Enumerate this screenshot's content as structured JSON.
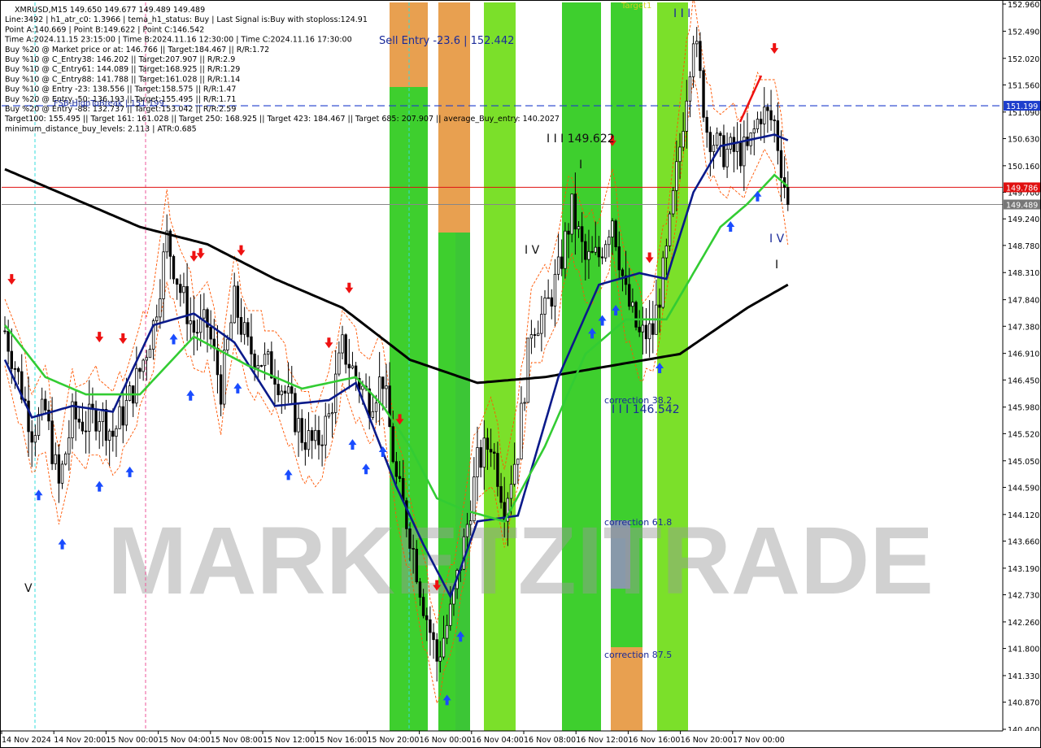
{
  "header": {
    "lines": [
      "XMRUSD,M15  149.650 149.677 149.489 149.489",
      "Line:3492 | h1_atr_c0: 1.3966 | tema_h1_status: Buy | Last Signal is:Buy with stoploss:124.91",
      "Point A:140.669 | Point B:149.622 | Point C:146.542",
      "Time A:2024.11.15 23:15:00 | Time B:2024.11.16 12:30:00 | Time C:2024.11.16 17:30:00",
      "Buy %20 @ Market price or at: 146.766 || Target:184.467 || R/R:1.72",
      "Buy %10 @ C_Entry38: 146.202 || Target:207.907 || R/R:2.9",
      "Buy %10 @ C_Entry61: 144.089 || Target:168.925 || R/R:1.29",
      "Buy %10 @ C_Entry88: 141.788 || Target:161.028 || R/R:1.14",
      "Buy %10 @ Entry -23: 138.556 || Target:158.575 || R/R:1.47",
      "Buy %20 @ Entry -50: 136.193 || Target:155.495 || R/R:1.71",
      "Buy %20 @ Entry -88: 132.737 || Target:153.042 || R/R:2.59",
      "Target100: 155.495 || Target 161: 161.028 || Target 250: 168.925 || Target 423: 184.467 || Target 685: 207.907 || average_Buy_entry: 140.2027",
      "minimum_distance_buy_levels: 2.113 | ATR:0.685"
    ]
  },
  "watermark": "MARKETZITRADE",
  "annotations": {
    "sell_entry": "Sell Entry -23.6 | 152.442",
    "target1": "Target1",
    "wave_B": "I I I 149.622",
    "wave_C": "I I I 146.542",
    "correction_382": "correction 38.2",
    "correction_618": "correction 61.8",
    "correction_875": "correction 87.5",
    "fsb": "FSB-HighToBreak | 151.199",
    "wave_top": "I I I",
    "wave_I_mid": "I",
    "wave_IV_mid": "I V",
    "wave_IV_right": "I V",
    "wave_I_right": "I",
    "wave_V_left": "V"
  },
  "price_axis": {
    "ticks": [
      "152.960",
      "152.490",
      "152.020",
      "151.560",
      "151.090",
      "150.630",
      "150.160",
      "149.700",
      "149.240",
      "148.780",
      "148.310",
      "147.840",
      "147.380",
      "146.910",
      "146.450",
      "145.980",
      "145.520",
      "145.050",
      "144.590",
      "144.120",
      "143.660",
      "143.190",
      "142.730",
      "142.260",
      "141.800",
      "141.330",
      "140.870",
      "140.400"
    ],
    "badges": [
      {
        "text": "151.199",
        "value": 151.199,
        "color": "#1e3ecc"
      },
      {
        "text": "149.786",
        "value": 149.786,
        "color": "#e01010"
      },
      {
        "text": "149.489",
        "value": 149.489,
        "color": "#777777"
      }
    ]
  },
  "time_axis": {
    "labels": [
      "14 Nov 2024",
      "14 Nov 20:00",
      "15 Nov 00:00",
      "15 Nov 04:00",
      "15 Nov 08:00",
      "15 Nov 12:00",
      "15 Nov 16:00",
      "15 Nov 20:00",
      "16 Nov 00:00",
      "16 Nov 04:00",
      "16 Nov 08:00",
      "16 Nov 12:00",
      "16 Nov 16:00",
      "16 Nov 20:00",
      "17 Nov 00:00"
    ]
  },
  "colors": {
    "zone_green": "#3ecf2e",
    "zone_green_light": "#7be02a",
    "zone_orange": "#e8a050",
    "ma_black": "#000000",
    "ma_navy": "#0a1a8a",
    "ma_green": "#33cc33",
    "envelope": "#ff5500",
    "buy_arrow": "#1a4cff",
    "sell_arrow": "#ee1111"
  },
  "chart_data": {
    "type": "candlestick",
    "symbol": "XMRUSD",
    "timeframe": "M15",
    "last_close": 149.489,
    "ylim": [
      140.4,
      152.96
    ],
    "levels": {
      "fsb_high_to_break": 151.199,
      "red_line": 149.786,
      "current_price": 149.489,
      "sell_entry": 152.442
    },
    "points": {
      "A": 140.669,
      "B": 149.622,
      "C": 146.542
    },
    "ohlc_path": [
      [
        0,
        147.3
      ],
      [
        4,
        146.5
      ],
      [
        8,
        145.6
      ],
      [
        12,
        145.9
      ],
      [
        16,
        144.6
      ],
      [
        20,
        145.8
      ],
      [
        24,
        145.7
      ],
      [
        28,
        145.9
      ],
      [
        32,
        145.5
      ],
      [
        36,
        146.0
      ],
      [
        40,
        146.6
      ],
      [
        44,
        147.4
      ],
      [
        48,
        148.9
      ],
      [
        52,
        148.0
      ],
      [
        56,
        147.3
      ],
      [
        60,
        147.4
      ],
      [
        64,
        146.3
      ],
      [
        68,
        147.8
      ],
      [
        72,
        147.0
      ],
      [
        76,
        146.8
      ],
      [
        80,
        146.6
      ],
      [
        84,
        146.1
      ],
      [
        88,
        145.5
      ],
      [
        92,
        145.3
      ],
      [
        96,
        145.8
      ],
      [
        100,
        147.0
      ],
      [
        104,
        146.5
      ],
      [
        108,
        146.1
      ],
      [
        112,
        146.5
      ],
      [
        116,
        144.7
      ],
      [
        120,
        143.8
      ],
      [
        124,
        142.6
      ],
      [
        128,
        141.6
      ],
      [
        132,
        142.4
      ],
      [
        136,
        143.6
      ],
      [
        140,
        145.0
      ],
      [
        144,
        145.4
      ],
      [
        148,
        144.3
      ],
      [
        152,
        145.3
      ],
      [
        156,
        147.4
      ],
      [
        160,
        147.6
      ],
      [
        164,
        148.3
      ],
      [
        168,
        149.4
      ],
      [
        172,
        148.5
      ],
      [
        176,
        148.6
      ],
      [
        180,
        149.3
      ],
      [
        184,
        147.9
      ],
      [
        188,
        147.2
      ],
      [
        192,
        147.3
      ],
      [
        196,
        148.6
      ],
      [
        200,
        150.5
      ],
      [
        204,
        152.5
      ],
      [
        208,
        150.8
      ],
      [
        212,
        150.4
      ],
      [
        216,
        150.4
      ],
      [
        220,
        150.4
      ],
      [
        224,
        151.1
      ],
      [
        228,
        150.9
      ],
      [
        232,
        149.49
      ]
    ],
    "series": [
      {
        "name": "",
        "color": "#000000",
        "values": [
          [
            0,
            150.1
          ],
          [
            20,
            149.6
          ],
          [
            40,
            149.1
          ],
          [
            60,
            148.8
          ],
          [
            80,
            148.2
          ],
          [
            100,
            147.7
          ],
          [
            120,
            146.8
          ],
          [
            140,
            146.4
          ],
          [
            160,
            146.5
          ],
          [
            180,
            146.7
          ],
          [
            200,
            146.9
          ],
          [
            220,
            147.7
          ],
          [
            232,
            148.1
          ]
        ]
      },
      {
        "name": "",
        "color": "#0a1a8a",
        "values": [
          [
            0,
            146.8
          ],
          [
            8,
            145.8
          ],
          [
            20,
            146.0
          ],
          [
            32,
            145.9
          ],
          [
            44,
            147.4
          ],
          [
            56,
            147.6
          ],
          [
            68,
            147.1
          ],
          [
            80,
            146.0
          ],
          [
            96,
            146.1
          ],
          [
            104,
            146.4
          ],
          [
            116,
            144.6
          ],
          [
            124,
            143.6
          ],
          [
            132,
            142.7
          ],
          [
            140,
            144.0
          ],
          [
            152,
            144.1
          ],
          [
            164,
            146.5
          ],
          [
            176,
            148.1
          ],
          [
            188,
            148.3
          ],
          [
            196,
            148.2
          ],
          [
            204,
            149.7
          ],
          [
            212,
            150.5
          ],
          [
            220,
            150.6
          ],
          [
            228,
            150.7
          ],
          [
            232,
            150.6
          ]
        ]
      },
      {
        "name": "",
        "color": "#33cc33",
        "values": [
          [
            0,
            147.4
          ],
          [
            12,
            146.5
          ],
          [
            24,
            146.2
          ],
          [
            40,
            146.2
          ],
          [
            56,
            147.2
          ],
          [
            72,
            146.7
          ],
          [
            88,
            146.3
          ],
          [
            104,
            146.5
          ],
          [
            112,
            146.0
          ],
          [
            120,
            145.3
          ],
          [
            128,
            144.4
          ],
          [
            136,
            144.2
          ],
          [
            148,
            144.0
          ],
          [
            160,
            145.3
          ],
          [
            172,
            146.9
          ],
          [
            184,
            147.5
          ],
          [
            196,
            147.5
          ],
          [
            204,
            148.3
          ],
          [
            212,
            149.1
          ],
          [
            220,
            149.5
          ],
          [
            228,
            150.0
          ],
          [
            232,
            149.8
          ]
        ]
      }
    ]
  }
}
